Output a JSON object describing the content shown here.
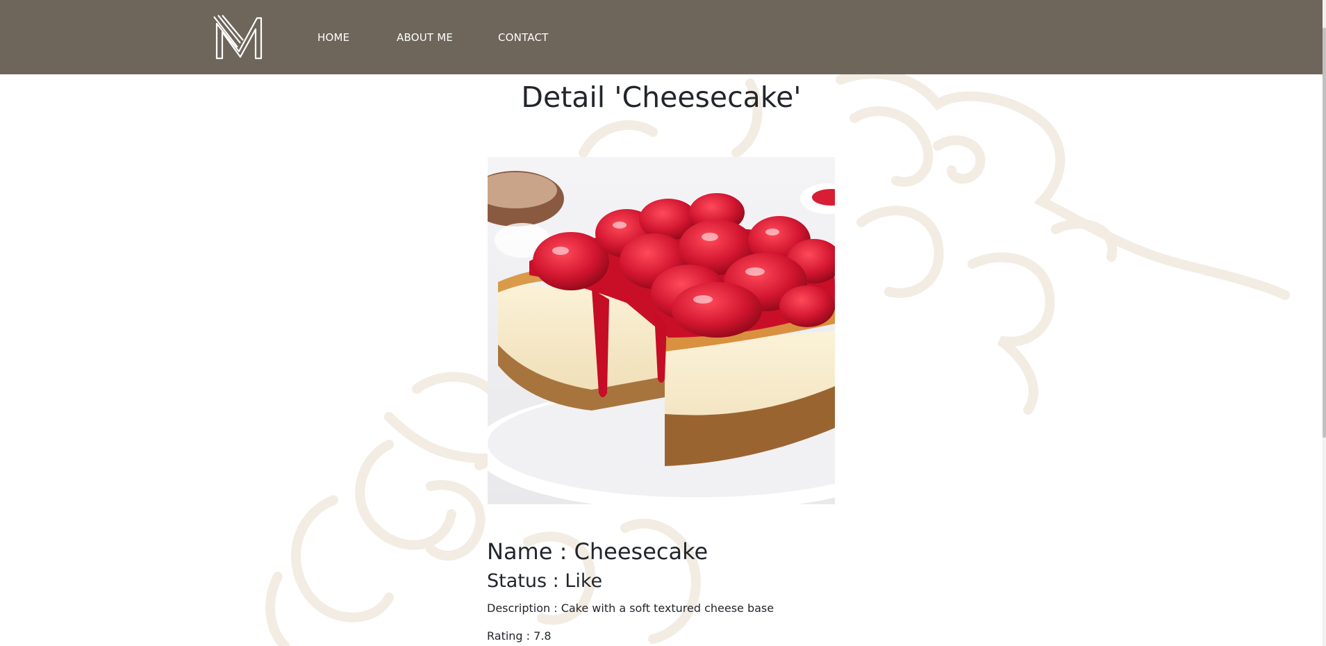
{
  "nav": {
    "logo_letter": "M",
    "links": [
      "HOME",
      "ABOUT ME",
      "CONTACT"
    ]
  },
  "page": {
    "title": "Detail 'Cheesecake'"
  },
  "product": {
    "image_alt": "Cheesecake",
    "name_line": "Name : Cheesecake",
    "status_line": "Status : Like",
    "description_line": "Description : Cake with a soft textured cheese base",
    "rating_line": "Rating : 7.8"
  },
  "colors": {
    "navbar": "#6e665b",
    "text": "#22252b",
    "swirl": "#f2ece3"
  }
}
